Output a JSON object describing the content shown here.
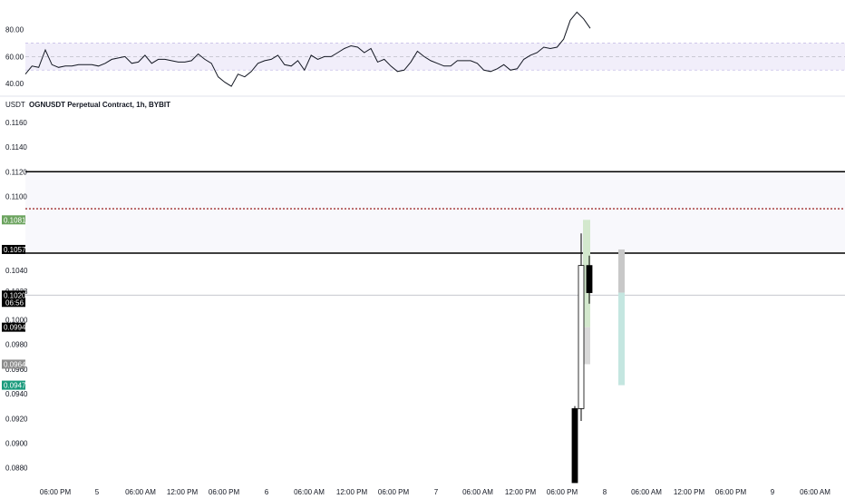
{
  "chart_data": [
    {
      "type": "line",
      "panel": "oscillator",
      "y_ticks": [
        "80.00",
        "60.00",
        "40.00"
      ],
      "ylim": [
        32,
        98
      ],
      "band": [
        50,
        70
      ],
      "series": [
        {
          "values": [
            47,
            53,
            52,
            65,
            54,
            52,
            53,
            53,
            54,
            54,
            54,
            53,
            55,
            58,
            59,
            60,
            55,
            56,
            61,
            55,
            58,
            58,
            57,
            56,
            56,
            57,
            62,
            58,
            55,
            45,
            41,
            38,
            47,
            45,
            49,
            55,
            57,
            58,
            61,
            54,
            53,
            57,
            50,
            61,
            58,
            60,
            60,
            63,
            66,
            68,
            67,
            63,
            66,
            56,
            58,
            53,
            49,
            50,
            56,
            64,
            60,
            57,
            55,
            53,
            53,
            57,
            57,
            57,
            55,
            50,
            49,
            51,
            54,
            50,
            51,
            58,
            61,
            63,
            67,
            66,
            67,
            73,
            87,
            93,
            88,
            81
          ]
        }
      ],
      "colors": {
        "line": "#131722",
        "band": "#f1eefa",
        "band_edge": "#c7bfe6",
        "mid": "#b2b5be"
      }
    },
    {
      "type": "candlestick",
      "panel": "price",
      "title": "OGNUSDT Perpetual Contract, 1h, BYBIT",
      "unit_label": "USDT",
      "ylim": [
        0.0868,
        0.1168
      ],
      "y_ticks": [
        "0.1160",
        "0.1140",
        "0.1120",
        "0.1100",
        "0.1040",
        "0.1023",
        "0.1000",
        "0.0980",
        "0.0960",
        "0.0940",
        "0.0920",
        "0.0900",
        "0.0880"
      ],
      "x_ticks": [
        "06:00 PM",
        "5",
        "06:00 AM",
        "12:00 PM",
        "06:00 PM",
        "6",
        "06:00 AM",
        "12:00 PM",
        "06:00 PM",
        "7",
        "06:00 AM",
        "12:00 PM",
        "06:00 PM",
        "8",
        "06:00 AM",
        "12:00 PM",
        "06:00 PM",
        "9",
        "06:00 AM"
      ],
      "candles": [
        {
          "open": 0.078,
          "high": 0.093,
          "low": 0.078,
          "close": 0.0928,
          "color": "#000000"
        },
        {
          "open": 0.0928,
          "high": 0.107,
          "low": 0.0918,
          "close": 0.1044,
          "color": "#ffffff"
        },
        {
          "open": 0.1044,
          "high": 0.1052,
          "low": 0.1013,
          "close": 0.1022,
          "color": "#000000"
        }
      ],
      "hlines": [
        {
          "value": 0.112,
          "style": "solid",
          "color": "#000000"
        },
        {
          "value": 0.109,
          "style": "dotted",
          "color": "#8b0000"
        },
        {
          "value": 0.1054,
          "style": "solid",
          "color": "#000000"
        },
        {
          "value": 0.102,
          "style": "thin",
          "color": "#b2b5be"
        }
      ],
      "zone": [
        0.1054,
        0.112
      ],
      "position_boxes": [
        {
          "from": 0.0994,
          "to": 0.1081,
          "color": "#d3e8cd"
        },
        {
          "from": 0.0964,
          "to": 0.0994,
          "color": "#d9d9d9"
        },
        {
          "from": 0.1022,
          "to": 0.1057,
          "color": "#c8c8c8"
        },
        {
          "from": 0.0947,
          "to": 0.1022,
          "color": "#c4e6e0"
        }
      ],
      "badges": [
        {
          "text": "0.1081",
          "value": 0.1081,
          "color": "#6ba35e"
        },
        {
          "text": "0.1057",
          "value": 0.1057,
          "color": "#000000"
        },
        {
          "text": "0.1020",
          "value": 0.102,
          "color": "#000000",
          "sub": "06:56"
        },
        {
          "text": "0.0994",
          "value": 0.0994,
          "color": "#000000"
        },
        {
          "text": "0.0964",
          "value": 0.0964,
          "color": "#8c8c8c"
        },
        {
          "text": "0.0947",
          "value": 0.0947,
          "color": "#1a9a7c"
        }
      ]
    }
  ]
}
